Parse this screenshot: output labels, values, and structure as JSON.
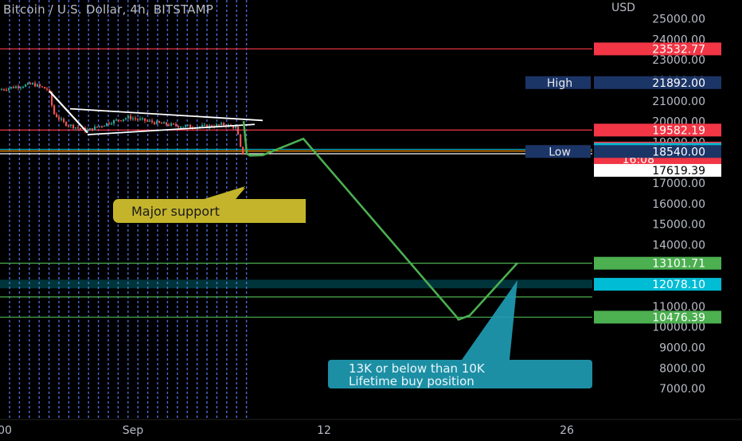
{
  "header": {
    "symbol_title": "Bitcoin / U.S. Dollar, 4h, BITSTAMP",
    "currency": "USD"
  },
  "chart_data": {
    "type": "candlestick",
    "title": "Bitcoin / U.S. Dollar, 4h, BITSTAMP",
    "ylabel": "USD",
    "ylim": [
      6600,
      25600
    ],
    "y_ticks": [
      7000,
      8000,
      9000,
      10000,
      11000,
      12000,
      13000,
      14000,
      15000,
      16000,
      17000,
      18000,
      19000,
      20000,
      21000,
      22000,
      23000,
      24000,
      25000
    ],
    "y_tick_labels": [
      "7000.00",
      "8000.00",
      "9000.00",
      "10000.00",
      "11000.00",
      "12000.00",
      "13000.00",
      "14000.00",
      "15000.00",
      "16000.00",
      "17000.00",
      "18000.00",
      "19000.00",
      "20000.00",
      "21000.00",
      "22000.00",
      "23000.00",
      "24000.00",
      "25000.00"
    ],
    "x_tick_labels": [
      "00",
      "Sep",
      "12",
      "26"
    ],
    "price_markers": [
      {
        "label": "",
        "value": "23532.77",
        "price": 23532.77,
        "color": "#f23645"
      },
      {
        "label": "High",
        "value": "21892.00",
        "price": 21892,
        "color": "#1c3567"
      },
      {
        "label": "",
        "value": "19582.19",
        "price": 19582.19,
        "color": "#f23645"
      },
      {
        "label": "",
        "value": "18707.00",
        "sub": "16:08",
        "price": 18707,
        "color": "#f23645"
      },
      {
        "label": "",
        "value": "18645.20",
        "price": 18645.2,
        "color": "#00bcd4"
      },
      {
        "label": "Low",
        "value": "18540.00",
        "price": 18540,
        "color": "#1c3567"
      },
      {
        "label": "",
        "value": "17619.39",
        "price": 17619.39,
        "color": "#ffffff"
      },
      {
        "label": "",
        "value": "13101.71",
        "price": 13101.71,
        "color": "#4caf50"
      },
      {
        "label": "",
        "value": "12078.10",
        "price": 12078.1,
        "color": "#00bcd4"
      },
      {
        "label": "",
        "value": "10476.39",
        "price": 10476.39,
        "color": "#4caf50"
      }
    ],
    "horizontal_lines": [
      {
        "price": 23532.77,
        "color": "#f23645"
      },
      {
        "price": 19582.19,
        "color": "#f23645"
      },
      {
        "price": 18645.2,
        "color": "#00bcd4"
      },
      {
        "price": 18560,
        "color": "#ff9800"
      },
      {
        "price": 18430,
        "color": "#ffffff"
      },
      {
        "price": 13101.71,
        "color": "#4caf50"
      },
      {
        "price": 11460,
        "color": "#4caf50"
      },
      {
        "price": 10476.39,
        "color": "#4caf50"
      }
    ],
    "zone": {
      "from": 12300,
      "to": 11880,
      "color": "#00bcd4"
    },
    "annotations": [
      {
        "text": "Major support",
        "style": "callout",
        "color": "#c4b42c"
      },
      {
        "text": "13K or below than 10K",
        "text2": "Lifetime buy position",
        "style": "callout",
        "color": "#1f9bb3"
      }
    ],
    "projection_path": [
      20020,
      18440,
      18340,
      18360,
      19160,
      10560,
      10360,
      10560,
      13120
    ],
    "triangle_top": [
      20620,
      20050
    ],
    "triangle_bottom": [
      19360,
      19860
    ],
    "initial_trend": [
      21480,
      19450
    ],
    "colors": {
      "up": "#26a69a",
      "down": "#ef5350",
      "grid_vertical": "#5b7cff",
      "projection": "#4caf50"
    }
  }
}
